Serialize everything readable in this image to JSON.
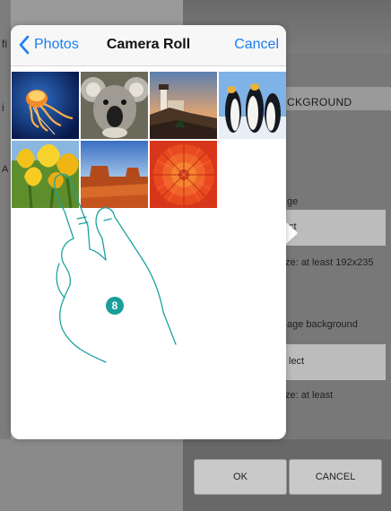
{
  "background": {
    "left_fragments": [
      "fi",
      "i",
      "A"
    ],
    "section_title": "CKGROUND",
    "field1_label": "ge",
    "field1_select": "ct",
    "field1_hint": "ze: at least 192x235",
    "field2_label": "age background",
    "field2_select": "lect",
    "field2_hint": "ze: at least",
    "ok_label": "OK",
    "cancel_label": "CANCEL"
  },
  "picker": {
    "back_label": "Photos",
    "title": "Camera Roll",
    "cancel_label": "Cancel",
    "back_icon": "chevron-left-icon",
    "accent_color": "#1a7ef5",
    "photos": [
      {
        "name": "jellyfish"
      },
      {
        "name": "koala"
      },
      {
        "name": "lighthouse"
      },
      {
        "name": "penguins"
      },
      {
        "name": "tulips"
      },
      {
        "name": "desert"
      },
      {
        "name": "chrysanthemum"
      }
    ]
  },
  "instruction": {
    "step": "8",
    "badge_color": "#1a9f9a",
    "gesture_icon": "hand-tap-icon"
  }
}
